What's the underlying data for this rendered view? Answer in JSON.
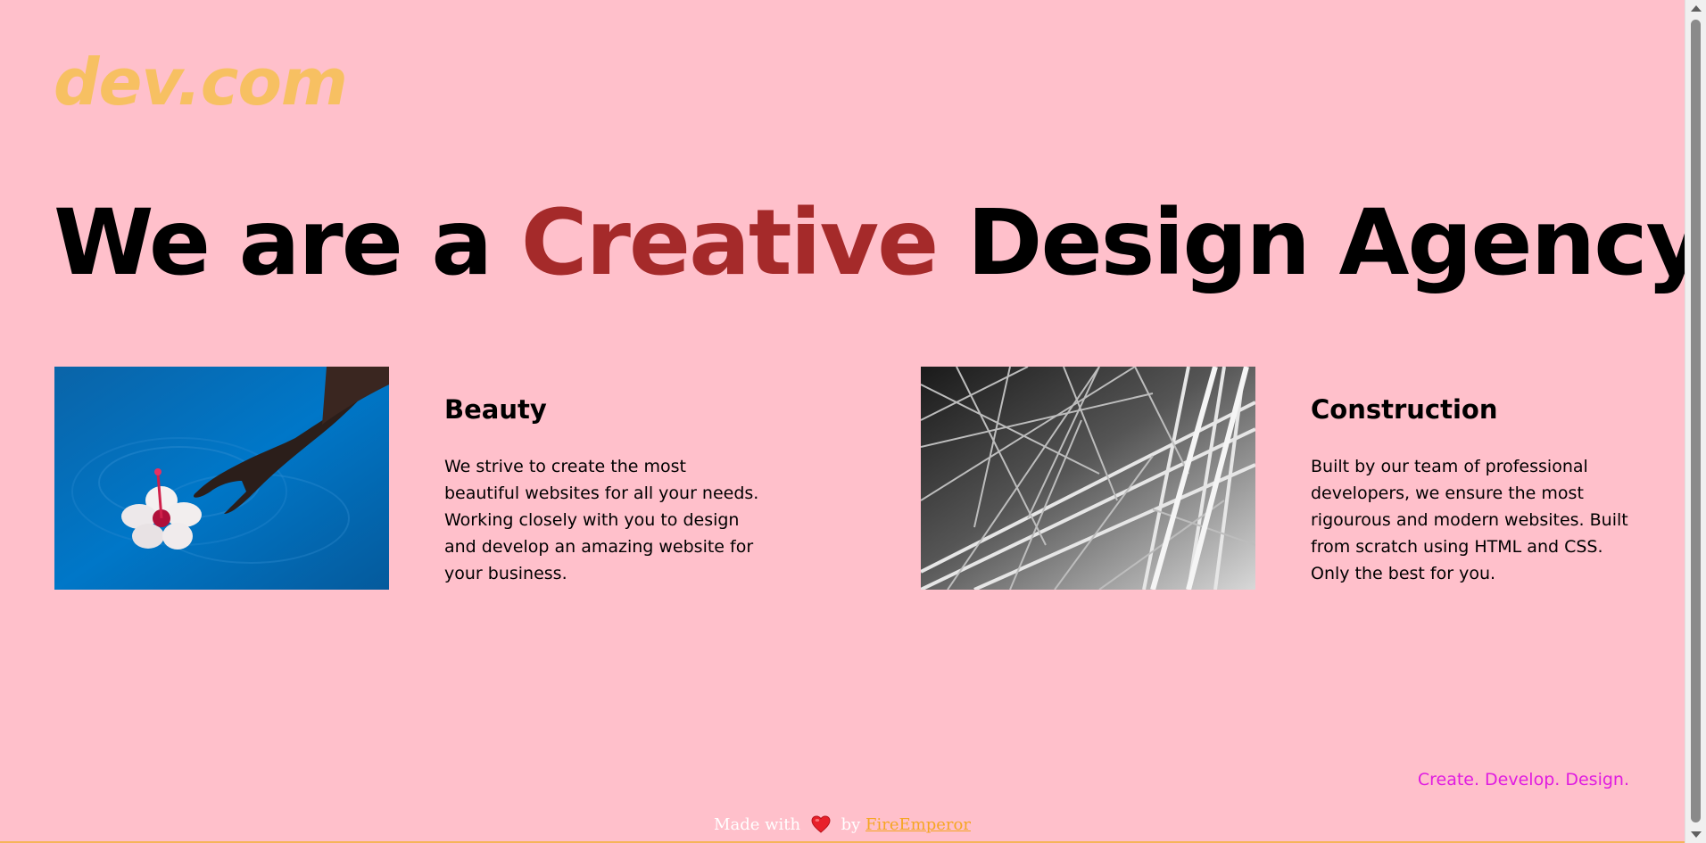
{
  "header": {
    "logo_text": "dev.com"
  },
  "hero": {
    "prefix": "We are a ",
    "accent": "Creative",
    "suffix": " Design Agency"
  },
  "features": [
    {
      "title": "Beauty",
      "text": "We strive to create the most beautiful websites for all your needs. Working closely with you to design and develop an amazing website for your business."
    },
    {
      "title": "Construction",
      "text": "Built by our team of professional developers, we ensure the most rigourous and modern websites. Built from scratch using HTML and CSS. Only the best for you."
    }
  ],
  "tagline": "Create. Develop. Design.",
  "footer": {
    "made_with": "Made with",
    "by": "by",
    "author": "FireEmperor",
    "heart_icon": "heart-icon"
  },
  "colors": {
    "background": "#FFC0CB",
    "logo": "#F7C062",
    "hero_text": "#000000",
    "hero_accent": "#A52A2A",
    "tagline": "#E01CE0",
    "footer_text": "#FFFFFF",
    "footer_link": "#F5A623"
  }
}
